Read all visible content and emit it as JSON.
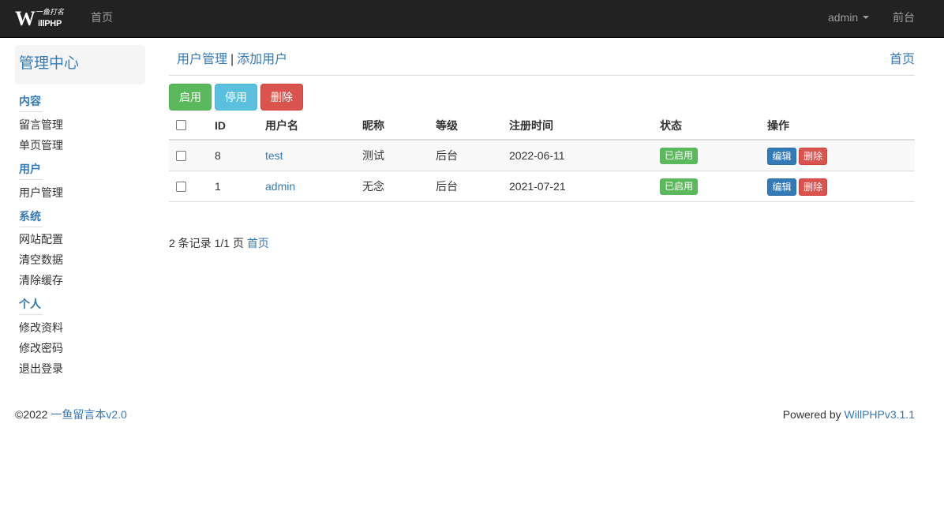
{
  "navbar": {
    "logo_big": "W",
    "logo_small": "illPHP",
    "logo_cn": "一鱼打名",
    "home": "首页",
    "user": "admin",
    "front": "前台"
  },
  "sidebar": {
    "title": "管理中心",
    "sections": [
      {
        "label": "内容",
        "items": [
          "留言管理",
          "单页管理"
        ]
      },
      {
        "label": "用户",
        "items": [
          "用户管理"
        ]
      },
      {
        "label": "系统",
        "items": [
          "网站配置",
          "清空数据",
          "清除缓存"
        ]
      },
      {
        "label": "个人",
        "items": [
          "修改资料",
          "修改密码",
          "退出登录"
        ]
      }
    ]
  },
  "main": {
    "breadcrumb": {
      "current": "用户管理",
      "separator": "|",
      "add": "添加用户"
    },
    "home_link": "首页",
    "actions": {
      "enable": "启用",
      "disable": "停用",
      "delete": "删除"
    },
    "table": {
      "headers": [
        "ID",
        "用户名",
        "昵称",
        "等级",
        "注册时间",
        "状态",
        "操作"
      ],
      "rows": [
        {
          "id": "8",
          "username": "test",
          "nickname": "测试",
          "level": "后台",
          "registered": "2022-06-11",
          "status": "已启用",
          "edit": "编辑",
          "delete": "删除"
        },
        {
          "id": "1",
          "username": "admin",
          "nickname": "无念",
          "level": "后台",
          "registered": "2021-07-21",
          "status": "已启用",
          "edit": "编辑",
          "delete": "删除"
        }
      ]
    },
    "pager": {
      "summary": "2 条记录 1/1 页",
      "first": "首页"
    }
  },
  "footer": {
    "copyright": "©2022",
    "site_name": "一鱼留言本v2.0",
    "powered_by": "Powered by",
    "engine": "WillPHPv3.1.1"
  },
  "colors": {
    "navbar_bg": "#222222",
    "link": "#337ab7",
    "success": "#5cb85c",
    "info": "#5bc0de",
    "danger": "#d9534f",
    "primary": "#337ab7"
  }
}
